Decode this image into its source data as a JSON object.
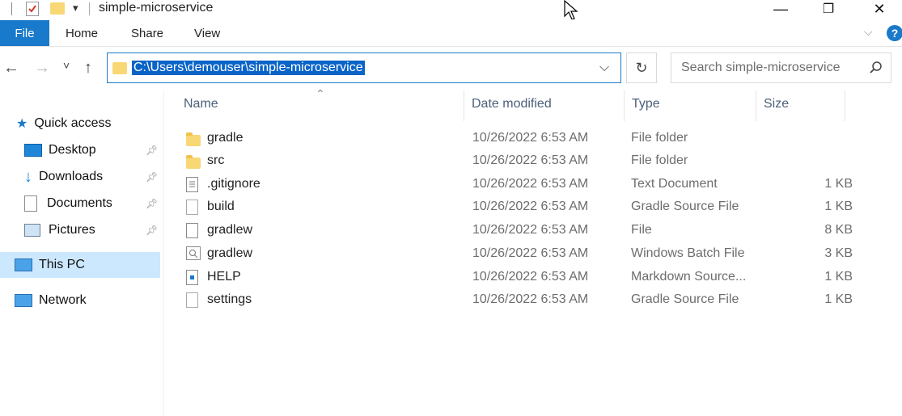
{
  "window": {
    "title": "simple-microservice",
    "controls": {
      "minimize": "—",
      "restore": "❐",
      "close": "✕"
    }
  },
  "ribbon": {
    "tabs": [
      "File",
      "Home",
      "Share",
      "View"
    ],
    "help": "?"
  },
  "nav": {
    "back": "←",
    "forward": "→",
    "recent": "˅",
    "up": "↑"
  },
  "address": {
    "path": "C:\\Users\\demouser\\simple-microservice",
    "dropdown": "⌵",
    "refresh": "↻"
  },
  "search": {
    "placeholder": "Search simple-microservice",
    "icon": "search-icon"
  },
  "navpane": {
    "quick_access": "Quick access",
    "items": [
      {
        "label": "Desktop",
        "icon": "desktop-icon",
        "pinned": true
      },
      {
        "label": "Downloads",
        "icon": "downloads-icon",
        "pinned": true
      },
      {
        "label": "Documents",
        "icon": "documents-icon",
        "pinned": true
      },
      {
        "label": "Pictures",
        "icon": "pictures-icon",
        "pinned": true
      }
    ],
    "this_pc": "This PC",
    "network": "Network"
  },
  "columns": {
    "name": "Name",
    "date": "Date modified",
    "type": "Type",
    "size": "Size",
    "sort_indicator": "⌃"
  },
  "files": [
    {
      "name": "gradle",
      "date": "10/26/2022 6:53 AM",
      "type": "File folder",
      "size": "",
      "icon": "folder-icon"
    },
    {
      "name": "src",
      "date": "10/26/2022 6:53 AM",
      "type": "File folder",
      "size": "",
      "icon": "folder-icon"
    },
    {
      "name": ".gitignore",
      "date": "10/26/2022 6:53 AM",
      "type": "Text Document",
      "size": "1 KB",
      "icon": "text-file-icon"
    },
    {
      "name": "build",
      "date": "10/26/2022 6:53 AM",
      "type": "Gradle Source File",
      "size": "1 KB",
      "icon": "gradle-file-icon"
    },
    {
      "name": "gradlew",
      "date": "10/26/2022 6:53 AM",
      "type": "File",
      "size": "8 KB",
      "icon": "blank-file-icon"
    },
    {
      "name": "gradlew",
      "date": "10/26/2022 6:53 AM",
      "type": "Windows Batch File",
      "size": "3 KB",
      "icon": "batch-file-icon"
    },
    {
      "name": "HELP",
      "date": "10/26/2022 6:53 AM",
      "type": "Markdown Source...",
      "size": "1 KB",
      "icon": "markdown-file-icon"
    },
    {
      "name": "settings",
      "date": "10/26/2022 6:53 AM",
      "type": "Gradle Source File",
      "size": "1 KB",
      "icon": "gradle-file-icon"
    }
  ],
  "colors": {
    "accent": "#1979ca",
    "selection": "#cce8ff",
    "folder": "#f8d775"
  }
}
